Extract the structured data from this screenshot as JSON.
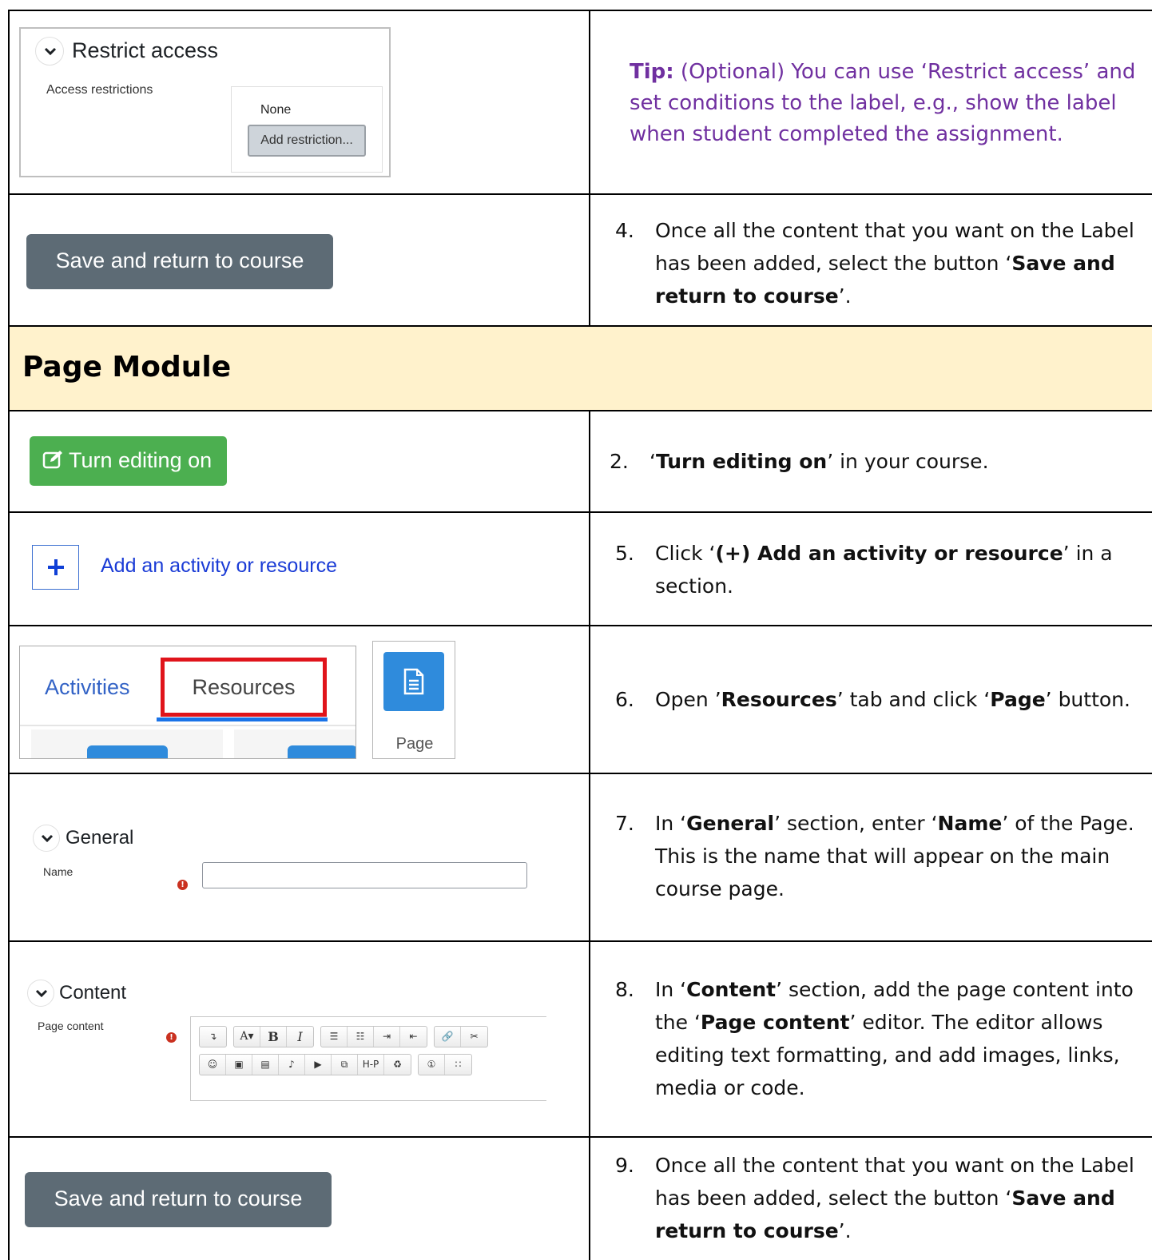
{
  "restrict_access": {
    "title": "Restrict access",
    "label": "Access restrictions",
    "none_text": "None",
    "add_button": "Add restriction..."
  },
  "tip": {
    "prefix": "Tip:",
    "text": " (Optional) You can use ‘Restrict access’ and set conditions to the label, e.g., show the label when student completed the assignment."
  },
  "save_button_label": "Save and return to course",
  "steps": {
    "s4": {
      "num": "4.",
      "pre": "Once all the content that you want on the Label has been added, select the button ‘",
      "bold": "Save and return to course",
      "post": "’."
    },
    "s2": {
      "num": "2.",
      "pre": "‘",
      "bold": "Turn editing on",
      "post": "’ in your course."
    },
    "s5": {
      "num": "5.",
      "pre": "Click ‘",
      "bold": "(+) Add an activity or resource",
      "post": "’ in a section."
    },
    "s6": {
      "num": "6.",
      "pre": "Open ’",
      "bold1": "Resources",
      "mid": "’ tab and click ‘",
      "bold2": "Page",
      "post": "’ button."
    },
    "s7": {
      "num": "7.",
      "pre": "In ‘",
      "bold1": "General",
      "mid": "’ section, enter ‘",
      "bold2": "Name",
      "post": "’ of the Page. This is the name that will appear on the main course page."
    },
    "s8": {
      "num": "8.",
      "pre": "In ‘",
      "bold1": "Content",
      "mid": "’ section, add the page content into the ‘",
      "bold2": "Page content",
      "post": "’ editor. The editor allows editing text formatting, and add images, links, media or code."
    },
    "s9": {
      "num": "9.",
      "pre": "Once all the content that you want on the Label has been added, select the button ‘",
      "bold": "Save and return to course",
      "post": "’."
    }
  },
  "section_header": "Page Module",
  "turn_editing_label": "Turn editing on",
  "add_activity_label": "Add an activity or resource",
  "chooser": {
    "tab_activities": "Activities",
    "tab_resources": "Resources",
    "page_label": "Page"
  },
  "general_form": {
    "title": "General",
    "name_label": "Name",
    "name_value": ""
  },
  "content_form": {
    "title": "Content",
    "page_content_label": "Page content"
  },
  "editor_toolbar": {
    "row1": [
      [
        "↴"
      ],
      [
        "A▾",
        "B",
        "I"
      ],
      [
        "☰",
        "☷",
        "⇥",
        "⇤"
      ],
      [
        "🔗",
        "✂"
      ]
    ],
    "row2": [
      [
        "☺",
        "▣",
        "▤",
        "♪",
        "▶",
        "⧉",
        "H-P",
        "♻"
      ],
      [
        "①",
        "∷"
      ]
    ]
  },
  "colors": {
    "tip": "#7030a0",
    "header_bg": "#fff2cc",
    "save_button": "#5d6b75",
    "edit_button": "#4caf50",
    "link": "#1a3bd6",
    "tab_highlight": "#e0141b"
  }
}
